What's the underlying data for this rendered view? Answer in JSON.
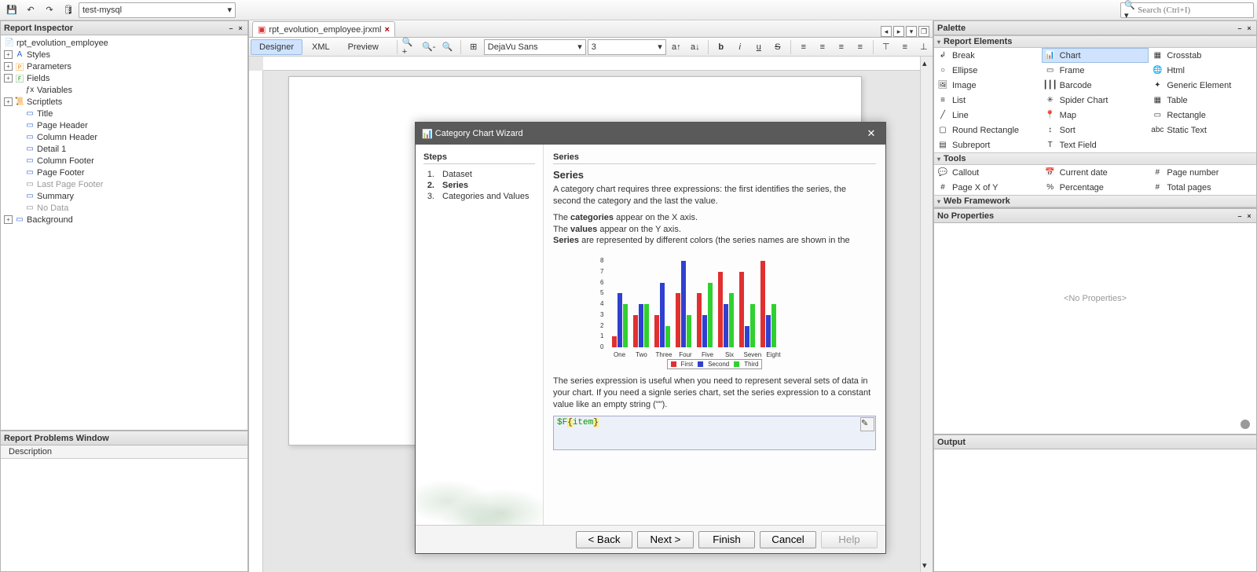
{
  "toolbar": {
    "datasource": "test-mysql",
    "search_placeholder": "Search (Ctrl+I)"
  },
  "inspector": {
    "title": "Report Inspector",
    "root": "rpt_evolution_employee",
    "items": [
      {
        "label": "Styles",
        "icon": "A",
        "cls": "c-blue",
        "exp": true
      },
      {
        "label": "Parameters",
        "icon": "🄿",
        "cls": "c-org",
        "exp": true
      },
      {
        "label": "Fields",
        "icon": "🄵",
        "cls": "c-grn",
        "exp": true
      },
      {
        "label": "Variables",
        "icon": "ƒx",
        "cls": "",
        "exp": false
      },
      {
        "label": "Scriptlets",
        "icon": "📜",
        "cls": "c-gray",
        "exp": true
      },
      {
        "label": "Title",
        "icon": "▭",
        "cls": "c-blue",
        "exp": false
      },
      {
        "label": "Page Header",
        "icon": "▭",
        "cls": "c-blue",
        "exp": false
      },
      {
        "label": "Column Header",
        "icon": "▭",
        "cls": "c-blue",
        "exp": false
      },
      {
        "label": "Detail 1",
        "icon": "▭",
        "cls": "c-blue",
        "exp": false
      },
      {
        "label": "Column Footer",
        "icon": "▭",
        "cls": "c-blue",
        "exp": false
      },
      {
        "label": "Page Footer",
        "icon": "▭",
        "cls": "c-blue",
        "exp": false
      },
      {
        "label": "Last Page Footer",
        "icon": "▭",
        "cls": "c-gray",
        "exp": false,
        "dim": true
      },
      {
        "label": "Summary",
        "icon": "▭",
        "cls": "c-blue",
        "exp": false
      },
      {
        "label": "No Data",
        "icon": "▭",
        "cls": "c-gray",
        "exp": false,
        "dim": true
      },
      {
        "label": "Background",
        "icon": "▭",
        "cls": "c-blue",
        "exp": true
      }
    ]
  },
  "problems": {
    "title": "Report Problems Window",
    "col": "Description"
  },
  "editor": {
    "file_tab": "rpt_evolution_employee.jrxml",
    "modes": [
      "Designer",
      "XML",
      "Preview"
    ],
    "font": "DejaVu Sans",
    "size": "3"
  },
  "palette": {
    "title": "Palette",
    "sections": {
      "report_elements": "Report Elements",
      "tools": "Tools",
      "web": "Web Framework"
    },
    "report_items": [
      {
        "label": "Break",
        "icon": "↲"
      },
      {
        "label": "Chart",
        "icon": "📊",
        "sel": true
      },
      {
        "label": "Crosstab",
        "icon": "▦"
      },
      {
        "label": "Ellipse",
        "icon": "○"
      },
      {
        "label": "Frame",
        "icon": "▭"
      },
      {
        "label": "Html",
        "icon": "🌐"
      },
      {
        "label": "Image",
        "icon": "🖼"
      },
      {
        "label": "Barcode",
        "icon": "┃┃┃"
      },
      {
        "label": "Generic Element",
        "icon": "✦"
      },
      {
        "label": "List",
        "icon": "≡"
      },
      {
        "label": "Spider Chart",
        "icon": "✳"
      },
      {
        "label": "Table",
        "icon": "▦"
      },
      {
        "label": "Line",
        "icon": "╱"
      },
      {
        "label": "Map",
        "icon": "📍"
      },
      {
        "label": "Rectangle",
        "icon": "▭"
      },
      {
        "label": "Round Rectangle",
        "icon": "▢"
      },
      {
        "label": "Sort",
        "icon": "↕"
      },
      {
        "label": "Static Text",
        "icon": "abc"
      },
      {
        "label": "Subreport",
        "icon": "▤"
      },
      {
        "label": "Text Field",
        "icon": "T"
      }
    ],
    "tool_items": [
      {
        "label": "Callout",
        "icon": "💬"
      },
      {
        "label": "Current date",
        "icon": "📅"
      },
      {
        "label": "Page number",
        "icon": "#"
      },
      {
        "label": "Page X of Y",
        "icon": "#"
      },
      {
        "label": "Percentage",
        "icon": "%"
      },
      {
        "label": "Total pages",
        "icon": "#"
      }
    ]
  },
  "props": {
    "title": "No Properties",
    "placeholder": "<No Properties>"
  },
  "output": {
    "title": "Output"
  },
  "dialog": {
    "title": "Category Chart Wizard",
    "steps_title": "Steps",
    "steps": [
      "Dataset",
      "Series",
      "Categories and Values"
    ],
    "active_step": 2,
    "right_title": "Series",
    "heading": "Series",
    "p1a": "A category chart requires three expressions: the first identifies the series, the second the category and the last the value.",
    "p2_a": "The ",
    "p2_b": "categories",
    "p2_c": " appear on the X axis.",
    "p3_a": "The ",
    "p3_b": "values",
    "p3_c": " appear on the Y axis.",
    "p4_a": "Series",
    "p4_b": " are represented by different colors (the series names are shown in the",
    "p5": "The series expression is useful when you need to represent several sets of data in your chart. If you need a signle series chart, set the series expression to a constant value like an empty string (\"\").",
    "expr_a": "$F",
    "expr_b": "{",
    "expr_c": "item",
    "expr_d": "}",
    "buttons": {
      "back": "< Back",
      "next": "Next >",
      "finish": "Finish",
      "cancel": "Cancel",
      "help": "Help"
    }
  },
  "chart_data": {
    "type": "bar",
    "title": "",
    "xlabel": "",
    "ylabel": "",
    "ylim": [
      0,
      8
    ],
    "yticks": [
      0,
      1,
      2,
      3,
      4,
      5,
      6,
      7,
      8
    ],
    "categories": [
      "One",
      "Two",
      "Three",
      "Four",
      "Five",
      "Six",
      "Seven",
      "Eight"
    ],
    "series": [
      {
        "name": "First",
        "color": "#e03030",
        "values": [
          1,
          3,
          3,
          5,
          5,
          7,
          7,
          8
        ]
      },
      {
        "name": "Second",
        "color": "#3040d0",
        "values": [
          5,
          4,
          6,
          8,
          3,
          4,
          2,
          3
        ]
      },
      {
        "name": "Third",
        "color": "#30d030",
        "values": [
          4,
          4,
          2,
          3,
          6,
          5,
          4,
          4
        ]
      }
    ],
    "legend": [
      "First",
      "Second",
      "Third"
    ]
  }
}
